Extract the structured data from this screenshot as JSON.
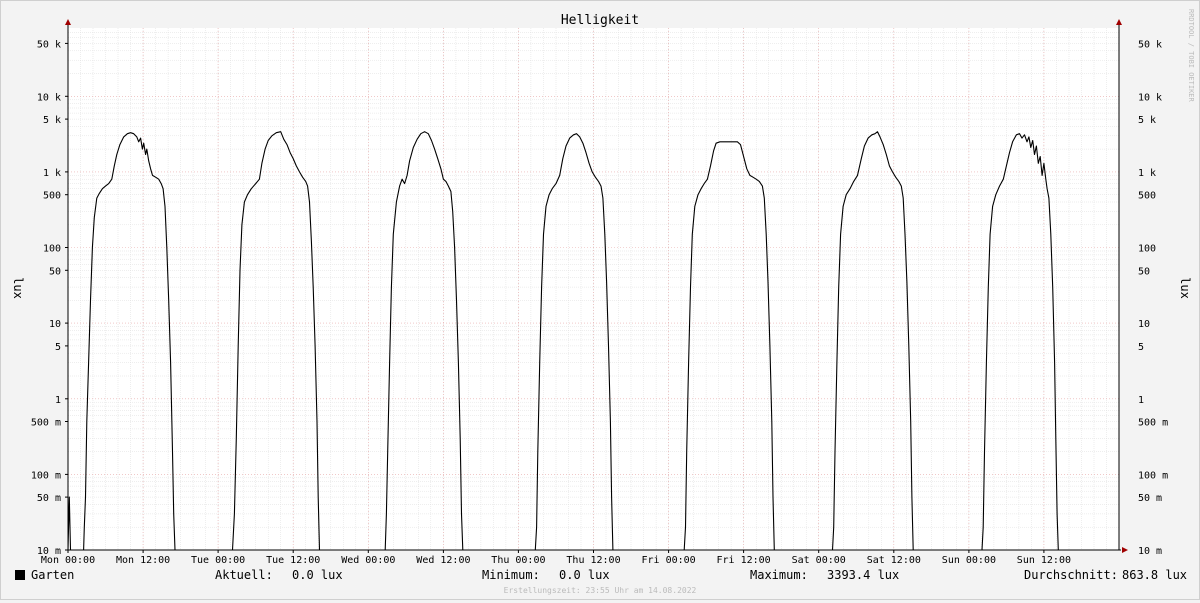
{
  "chart_data": {
    "type": "line",
    "title": "Helligkeit",
    "ylabel_left": "lux",
    "ylabel_right": "lux",
    "watermark": "RRDTOOL / TOBI OETIKER",
    "footer": "Erstellungszeit: 23:55 Uhr am 14.08.2022",
    "scale": "log",
    "ylim": [
      0.01,
      80000
    ],
    "xlim_hours": [
      0,
      168
    ],
    "grid": true,
    "x_ticks": [
      {
        "label": "Mon 00:00",
        "hour": 0
      },
      {
        "label": "Mon 12:00",
        "hour": 12
      },
      {
        "label": "Tue 00:00",
        "hour": 24
      },
      {
        "label": "Tue 12:00",
        "hour": 36
      },
      {
        "label": "Wed 00:00",
        "hour": 48
      },
      {
        "label": "Wed 12:00",
        "hour": 60
      },
      {
        "label": "Thu 00:00",
        "hour": 72
      },
      {
        "label": "Thu 12:00",
        "hour": 84
      },
      {
        "label": "Fri 00:00",
        "hour": 96
      },
      {
        "label": "Fri 12:00",
        "hour": 108
      },
      {
        "label": "Sat 00:00",
        "hour": 120
      },
      {
        "label": "Sat 12:00",
        "hour": 132
      },
      {
        "label": "Sun 00:00",
        "hour": 144
      },
      {
        "label": "Sun 12:00",
        "hour": 156
      }
    ],
    "y_ticks": [
      {
        "label": "10 m",
        "value": 0.01
      },
      {
        "label": "50 m",
        "value": 0.05
      },
      {
        "label": "100 m",
        "value": 0.1
      },
      {
        "label": "500 m",
        "value": 0.5
      },
      {
        "label": "1",
        "value": 1
      },
      {
        "label": "5",
        "value": 5
      },
      {
        "label": "10",
        "value": 10
      },
      {
        "label": "50",
        "value": 50
      },
      {
        "label": "100",
        "value": 100
      },
      {
        "label": "500",
        "value": 500
      },
      {
        "label": "1 k",
        "value": 1000
      },
      {
        "label": "5 k",
        "value": 5000
      },
      {
        "label": "10 k",
        "value": 10000
      },
      {
        "label": "50 k",
        "value": 50000
      }
    ],
    "series": [
      {
        "name": "Garten",
        "color": "#000000",
        "points": [
          [
            0,
            0
          ],
          [
            0.2,
            0.05
          ],
          [
            0.4,
            0
          ],
          [
            2.5,
            0
          ],
          [
            2.6,
            0.02
          ],
          [
            2.8,
            0.05
          ],
          [
            3.0,
            0.5
          ],
          [
            3.3,
            3
          ],
          [
            3.6,
            20
          ],
          [
            3.9,
            100
          ],
          [
            4.2,
            250
          ],
          [
            4.6,
            450
          ],
          [
            5,
            520
          ],
          [
            5.5,
            600
          ],
          [
            6,
            650
          ],
          [
            6.5,
            700
          ],
          [
            7,
            800
          ],
          [
            7.4,
            1200
          ],
          [
            7.8,
            1700
          ],
          [
            8.3,
            2300
          ],
          [
            8.9,
            2900
          ],
          [
            9.5,
            3200
          ],
          [
            10,
            3300
          ],
          [
            10.5,
            3200
          ],
          [
            11,
            2900
          ],
          [
            11.3,
            2500
          ],
          [
            11.6,
            2800
          ],
          [
            11.9,
            2000
          ],
          [
            12.1,
            2400
          ],
          [
            12.4,
            1700
          ],
          [
            12.6,
            2000
          ],
          [
            12.9,
            1400
          ],
          [
            13.2,
            1100
          ],
          [
            13.5,
            900
          ],
          [
            14,
            850
          ],
          [
            14.5,
            800
          ],
          [
            14.9,
            700
          ],
          [
            15.2,
            600
          ],
          [
            15.5,
            350
          ],
          [
            15.8,
            100
          ],
          [
            16.1,
            20
          ],
          [
            16.4,
            3
          ],
          [
            16.7,
            0.2
          ],
          [
            16.9,
            0.03
          ],
          [
            17.1,
            0
          ],
          [
            26.3,
            0
          ],
          [
            26.6,
            0.03
          ],
          [
            26.9,
            0.3
          ],
          [
            27.2,
            5
          ],
          [
            27.5,
            50
          ],
          [
            27.8,
            200
          ],
          [
            28.2,
            400
          ],
          [
            28.7,
            500
          ],
          [
            29.3,
            600
          ],
          [
            30,
            700
          ],
          [
            30.6,
            800
          ],
          [
            31,
            1300
          ],
          [
            31.5,
            2000
          ],
          [
            32,
            2600
          ],
          [
            32.6,
            3000
          ],
          [
            33.3,
            3300
          ],
          [
            34,
            3400
          ],
          [
            34.5,
            2700
          ],
          [
            35,
            2300
          ],
          [
            35.5,
            1800
          ],
          [
            36,
            1500
          ],
          [
            36.5,
            1200
          ],
          [
            37,
            1000
          ],
          [
            37.5,
            850
          ],
          [
            38,
            750
          ],
          [
            38.3,
            650
          ],
          [
            38.6,
            400
          ],
          [
            38.9,
            120
          ],
          [
            39.2,
            30
          ],
          [
            39.5,
            5
          ],
          [
            39.8,
            0.5
          ],
          [
            40,
            0.05
          ],
          [
            40.2,
            0
          ],
          [
            50.7,
            0
          ],
          [
            50.9,
            0.03
          ],
          [
            51.1,
            0.2
          ],
          [
            51.4,
            3
          ],
          [
            51.7,
            30
          ],
          [
            52,
            150
          ],
          [
            52.5,
            400
          ],
          [
            53,
            650
          ],
          [
            53.4,
            800
          ],
          [
            53.8,
            700
          ],
          [
            54.2,
            900
          ],
          [
            54.6,
            1400
          ],
          [
            55.2,
            2100
          ],
          [
            55.8,
            2700
          ],
          [
            56.4,
            3200
          ],
          [
            57,
            3400
          ],
          [
            57.6,
            3200
          ],
          [
            58.1,
            2600
          ],
          [
            58.6,
            2000
          ],
          [
            59.1,
            1500
          ],
          [
            59.6,
            1100
          ],
          [
            60,
            800
          ],
          [
            60.4,
            750
          ],
          [
            60.8,
            650
          ],
          [
            61.2,
            550
          ],
          [
            61.5,
            300
          ],
          [
            61.8,
            100
          ],
          [
            62.1,
            20
          ],
          [
            62.4,
            3
          ],
          [
            62.7,
            0.3
          ],
          [
            62.9,
            0.03
          ],
          [
            63.1,
            0
          ],
          [
            74.7,
            0
          ],
          [
            74.9,
            0.02
          ],
          [
            75.1,
            0.2
          ],
          [
            75.4,
            3
          ],
          [
            75.7,
            30
          ],
          [
            76,
            150
          ],
          [
            76.4,
            350
          ],
          [
            76.9,
            500
          ],
          [
            77.4,
            600
          ],
          [
            78,
            700
          ],
          [
            78.6,
            900
          ],
          [
            79.1,
            1500
          ],
          [
            79.6,
            2200
          ],
          [
            80.2,
            2800
          ],
          [
            80.8,
            3100
          ],
          [
            81.3,
            3200
          ],
          [
            81.8,
            2900
          ],
          [
            82.3,
            2400
          ],
          [
            82.8,
            1800
          ],
          [
            83.3,
            1300
          ],
          [
            83.8,
            1000
          ],
          [
            84.3,
            850
          ],
          [
            84.8,
            750
          ],
          [
            85.2,
            650
          ],
          [
            85.5,
            450
          ],
          [
            85.8,
            150
          ],
          [
            86.1,
            35
          ],
          [
            86.4,
            5
          ],
          [
            86.7,
            0.5
          ],
          [
            86.9,
            0.05
          ],
          [
            87.1,
            0
          ],
          [
            98.5,
            0
          ],
          [
            98.7,
            0.02
          ],
          [
            98.9,
            0.2
          ],
          [
            99.2,
            3
          ],
          [
            99.5,
            30
          ],
          [
            99.8,
            150
          ],
          [
            100.2,
            350
          ],
          [
            100.7,
            500
          ],
          [
            101.2,
            600
          ],
          [
            101.7,
            700
          ],
          [
            102.2,
            800
          ],
          [
            102.7,
            1200
          ],
          [
            103.2,
            1900
          ],
          [
            103.6,
            2400
          ],
          [
            104.2,
            2500
          ],
          [
            105.5,
            2500
          ],
          [
            107,
            2500
          ],
          [
            107.5,
            2300
          ],
          [
            108,
            1600
          ],
          [
            108.5,
            1100
          ],
          [
            109,
            900
          ],
          [
            109.5,
            850
          ],
          [
            110,
            800
          ],
          [
            110.5,
            750
          ],
          [
            111,
            650
          ],
          [
            111.3,
            450
          ],
          [
            111.6,
            150
          ],
          [
            111.9,
            35
          ],
          [
            112.2,
            5
          ],
          [
            112.5,
            0.5
          ],
          [
            112.7,
            0.05
          ],
          [
            112.9,
            0
          ],
          [
            122.2,
            0
          ],
          [
            122.4,
            0.02
          ],
          [
            122.6,
            0.2
          ],
          [
            122.9,
            3
          ],
          [
            123.2,
            30
          ],
          [
            123.5,
            150
          ],
          [
            123.9,
            350
          ],
          [
            124.4,
            500
          ],
          [
            125,
            600
          ],
          [
            125.6,
            750
          ],
          [
            126.2,
            900
          ],
          [
            126.8,
            1500
          ],
          [
            127.3,
            2200
          ],
          [
            127.9,
            2800
          ],
          [
            128.5,
            3100
          ],
          [
            129,
            3200
          ],
          [
            129.4,
            3400
          ],
          [
            129.8,
            2900
          ],
          [
            130.3,
            2300
          ],
          [
            130.8,
            1700
          ],
          [
            131.3,
            1200
          ],
          [
            131.8,
            1000
          ],
          [
            132.3,
            850
          ],
          [
            132.8,
            750
          ],
          [
            133.2,
            650
          ],
          [
            133.5,
            450
          ],
          [
            133.8,
            150
          ],
          [
            134.1,
            35
          ],
          [
            134.4,
            5
          ],
          [
            134.7,
            0.5
          ],
          [
            134.9,
            0.05
          ],
          [
            135.1,
            0
          ],
          [
            146.1,
            0
          ],
          [
            146.3,
            0.02
          ],
          [
            146.5,
            0.2
          ],
          [
            146.8,
            3
          ],
          [
            147.1,
            30
          ],
          [
            147.4,
            150
          ],
          [
            147.8,
            350
          ],
          [
            148.3,
            500
          ],
          [
            148.9,
            650
          ],
          [
            149.5,
            800
          ],
          [
            150,
            1200
          ],
          [
            150.5,
            1800
          ],
          [
            151,
            2500
          ],
          [
            151.6,
            3100
          ],
          [
            152.1,
            3200
          ],
          [
            152.5,
            2800
          ],
          [
            152.9,
            3100
          ],
          [
            153.3,
            2500
          ],
          [
            153.6,
            2900
          ],
          [
            153.9,
            2100
          ],
          [
            154.2,
            2600
          ],
          [
            154.5,
            1700
          ],
          [
            154.8,
            2200
          ],
          [
            155.1,
            1300
          ],
          [
            155.4,
            1600
          ],
          [
            155.7,
            900
          ],
          [
            156,
            1300
          ],
          [
            156.3,
            800
          ],
          [
            156.5,
            600
          ],
          [
            156.8,
            450
          ],
          [
            157.1,
            150
          ],
          [
            157.4,
            30
          ],
          [
            157.7,
            3
          ],
          [
            157.9,
            0.3
          ],
          [
            158.1,
            0.03
          ],
          [
            158.3,
            0
          ]
        ]
      }
    ]
  },
  "legend": {
    "series_name": "Garten",
    "aktuell_label": "Aktuell:",
    "aktuell_value": "0.0 lux",
    "minimum_label": "Minimum:",
    "minimum_value": "0.0 lux",
    "maximum_label": "Maximum:",
    "maximum_value": "3393.4 lux",
    "durchschnitt_label": "Durchschnitt:",
    "durchschnitt_value": "863.8 lux"
  }
}
